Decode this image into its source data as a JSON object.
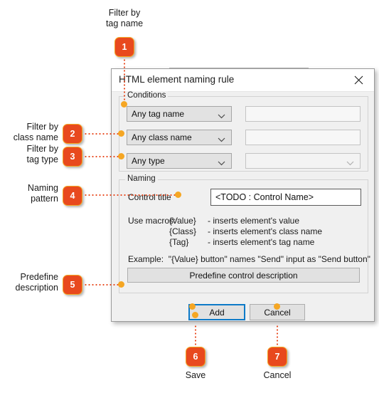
{
  "background": {
    "cut_text": "",
    "accent": "#e8491e",
    "badge_outline": "#f5a623",
    "focus_blue": "#0d7ac8",
    "dialog_bg": "#f0f0f0"
  },
  "dialog": {
    "title": "HTML element naming rule",
    "close_icon": "close-icon",
    "conditions": {
      "legend": "Conditions",
      "rows": [
        {
          "combo": "Any tag name",
          "value": "",
          "value_placeholder": "",
          "value_kind": "textbox"
        },
        {
          "combo": "Any class name",
          "value": "",
          "value_placeholder": "",
          "value_kind": "textbox"
        },
        {
          "combo": "Any type",
          "value": "",
          "value_placeholder": "",
          "value_kind": "combobox"
        }
      ],
      "chevron_icon": "chevron-down-icon"
    },
    "naming": {
      "legend": "Naming",
      "control_title_label": "Control title",
      "control_title_value": "<TODO : Control Name>",
      "macros_label": "Use macros:",
      "macros": [
        {
          "key": "{Value}",
          "desc": "- inserts element's value"
        },
        {
          "key": "{Class}",
          "desc": "- inserts element's class name"
        },
        {
          "key": "{Tag}",
          "desc": "- inserts element's tag name"
        }
      ],
      "example": "Example:  \"{Value} button\" names \"Send\" input as \"Send button\"",
      "predefine_button": "Predefine control description"
    },
    "buttons": {
      "add": "Add",
      "cancel": "Cancel"
    }
  },
  "annotations": [
    {
      "num": "1",
      "label": "Filter by\ntag name"
    },
    {
      "num": "2",
      "label": "Filter by\nclass name"
    },
    {
      "num": "3",
      "label": "Filter by\ntag type"
    },
    {
      "num": "4",
      "label": "Naming\npattern"
    },
    {
      "num": "5",
      "label": "Predefine\ndescription"
    },
    {
      "num": "6",
      "label": "Save"
    },
    {
      "num": "7",
      "label": "Cancel"
    }
  ]
}
